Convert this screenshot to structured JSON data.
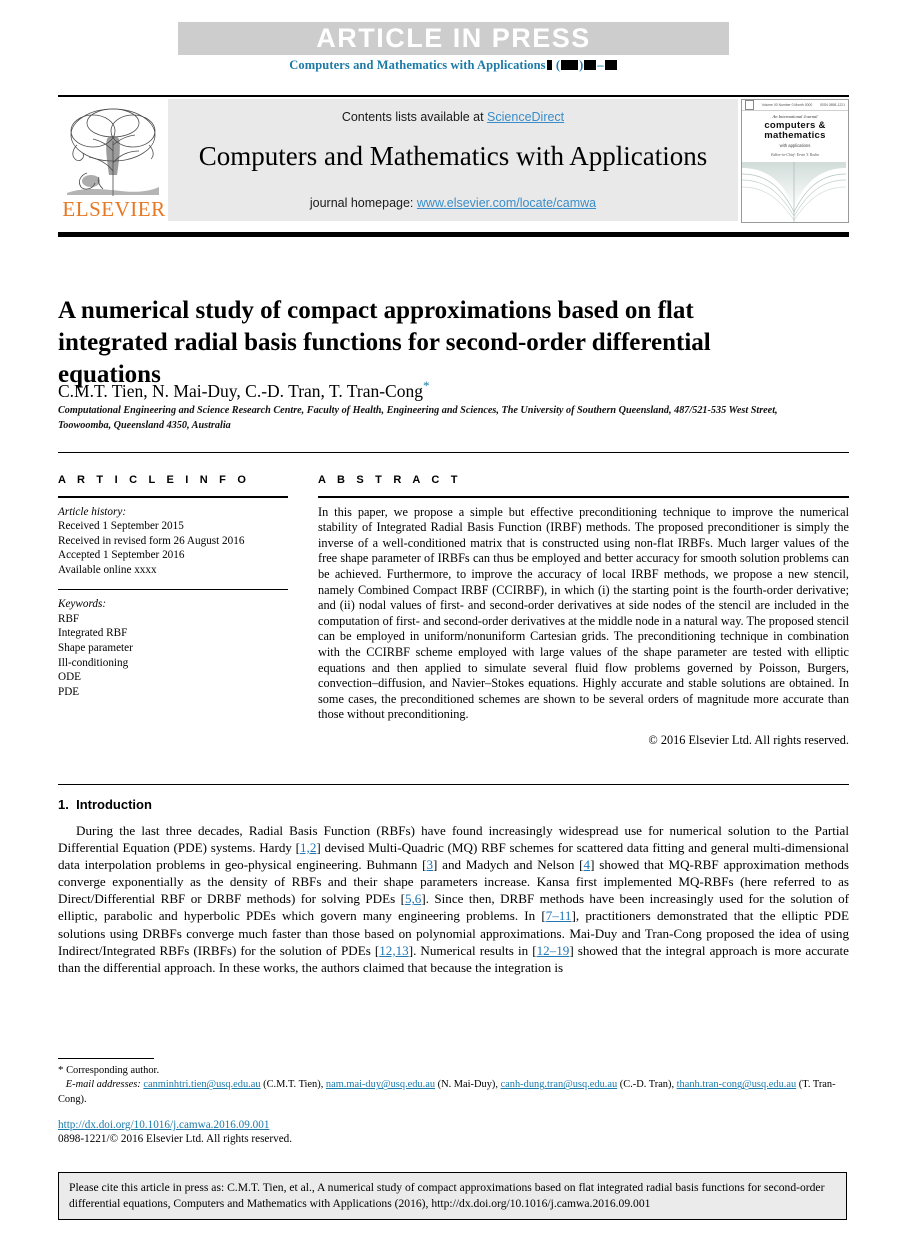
{
  "banner": {
    "text": "ARTICLE  IN  PRESS",
    "journal_ref_prefix": "Computers and Mathematics with Applications",
    "accent_color": "#1a7aa8",
    "band_color": "#cdcdcd"
  },
  "masthead": {
    "publisher_logo_text": "ELSEVIER",
    "publisher_color": "#e87722",
    "contents_prefix": "Contents lists available at ",
    "contents_link": "ScienceDirect",
    "journal_title": "Computers and Mathematics with Applications",
    "homepage_prefix": "journal homepage: ",
    "homepage_link": "www.elsevier.com/locate/camwa",
    "link_color": "#3a8dc9",
    "cover": {
      "top_left": "Volume 00  Number 0  Month 0000",
      "top_right": "ISSN 0898-1221",
      "subtitle": "An International Journal",
      "title_line1": "computers &",
      "title_line2": "mathematics",
      "subtitle2": "with applications",
      "editor": "Editor-in-Chief:  Ervin Y.  Rodin"
    }
  },
  "article": {
    "title": "A numerical study of compact approximations based on flat integrated radial basis functions for second-order differential equations",
    "authors": "C.M.T. Tien, N. Mai-Duy, C.-D. Tran, T. Tran-Cong",
    "corresponding_marker": "*",
    "affiliation": "Computational Engineering and Science Research Centre, Faculty of Health, Engineering and Sciences, The University of Southern Queensland, 487/521-535 West Street, Toowoomba, Queensland 4350, Australia"
  },
  "info": {
    "heading": "A R T I C L E   I N F O",
    "history_label": "Article history:",
    "history": [
      "Received 1 September 2015",
      "Received in revised form 26 August 2016",
      "Accepted 1 September 2016",
      "Available online xxxx"
    ],
    "keywords_label": "Keywords:",
    "keywords": [
      "RBF",
      "Integrated RBF",
      "Shape parameter",
      "Ill-conditioning",
      "ODE",
      "PDE"
    ]
  },
  "abstract": {
    "heading": "A B S T R A C T",
    "text": "In this paper, we propose a simple but effective preconditioning technique to improve the numerical stability of Integrated Radial Basis Function (IRBF) methods. The proposed preconditioner is simply the inverse of a well-conditioned matrix that is constructed using non-flat IRBFs. Much larger values of the free shape parameter of IRBFs can thus be employed and better accuracy for smooth solution problems can be achieved. Furthermore, to improve the accuracy of local IRBF methods, we propose a new stencil, namely Combined Compact IRBF (CCIRBF), in which (i) the starting point is the fourth-order derivative; and (ii) nodal values of first- and second-order derivatives at side nodes of the stencil are included in the computation of first- and second-order derivatives at the middle node in a natural way. The proposed stencil can be employed in uniform/nonuniform Cartesian grids. The preconditioning technique in combination with the CCIRBF scheme employed with large values of the shape parameter are tested with elliptic equations and then applied to simulate several fluid flow problems governed by Poisson, Burgers, convection–diffusion, and Navier–Stokes equations. Highly accurate and stable solutions are obtained. In some cases, the preconditioned schemes are shown to be several orders of magnitude more accurate than those without preconditioning.",
    "copyright": "© 2016 Elsevier Ltd. All rights reserved."
  },
  "introduction": {
    "number": "1.",
    "heading": "Introduction",
    "paragraph_parts": [
      "During the last three decades, Radial Basis Function (RBFs) have found increasingly widespread use for numerical solution to the Partial Differential Equation (PDE) systems. Hardy [",
      "1,2",
      "] devised Multi-Quadric (MQ) RBF schemes for scattered data fitting and general multi-dimensional data interpolation problems in geo-physical engineering. Buhmann [",
      "3",
      "] and Madych and Nelson [",
      "4",
      "] showed that MQ-RBF approximation methods converge exponentially as the density of RBFs and their shape parameters increase. Kansa first implemented MQ-RBFs (here referred to as Direct/Differential RBF or DRBF methods) for solving PDEs [",
      "5,6",
      "]. Since then, DRBF methods have been increasingly used for the solution of elliptic, parabolic and hyperbolic PDEs which govern many engineering problems. In [",
      "7–11",
      "], practitioners demonstrated that the elliptic PDE solutions using DRBFs converge much faster than those based on polynomial approximations. Mai-Duy and Tran-Cong proposed the idea of using Indirect/Integrated RBFs (IRBFs) for the solution of PDEs [",
      "12,13",
      "]. Numerical results in [",
      "12–19",
      "] showed that the integral approach is more accurate than the differential approach. In these works, the authors claimed that because the integration is"
    ]
  },
  "footnotes": {
    "corresponding": "Corresponding author.",
    "email_label": "E-mail addresses:",
    "emails": [
      {
        "address": "canminhtri.tien@usq.edu.au",
        "name": "(C.M.T. Tien)"
      },
      {
        "address": "nam.mai-duy@usq.edu.au",
        "name": "(N. Mai-Duy)"
      },
      {
        "address": "canh-dung.tran@usq.edu.au",
        "name": "(C.-D. Tran)"
      },
      {
        "address": "thanh.tran-cong@usq.edu.au",
        "name": "(T. Tran-Cong)"
      }
    ],
    "doi": "http://dx.doi.org/10.1016/j.camwa.2016.09.001",
    "issn": "0898-1221/© 2016 Elsevier Ltd. All rights reserved."
  },
  "cite_box": {
    "text": "Please cite this article in press as: C.M.T. Tien, et al., A numerical study of compact approximations based on flat integrated radial basis functions for second-order differential equations, Computers and Mathematics with Applications (2016), http://dx.doi.org/10.1016/j.camwa.2016.09.001"
  }
}
